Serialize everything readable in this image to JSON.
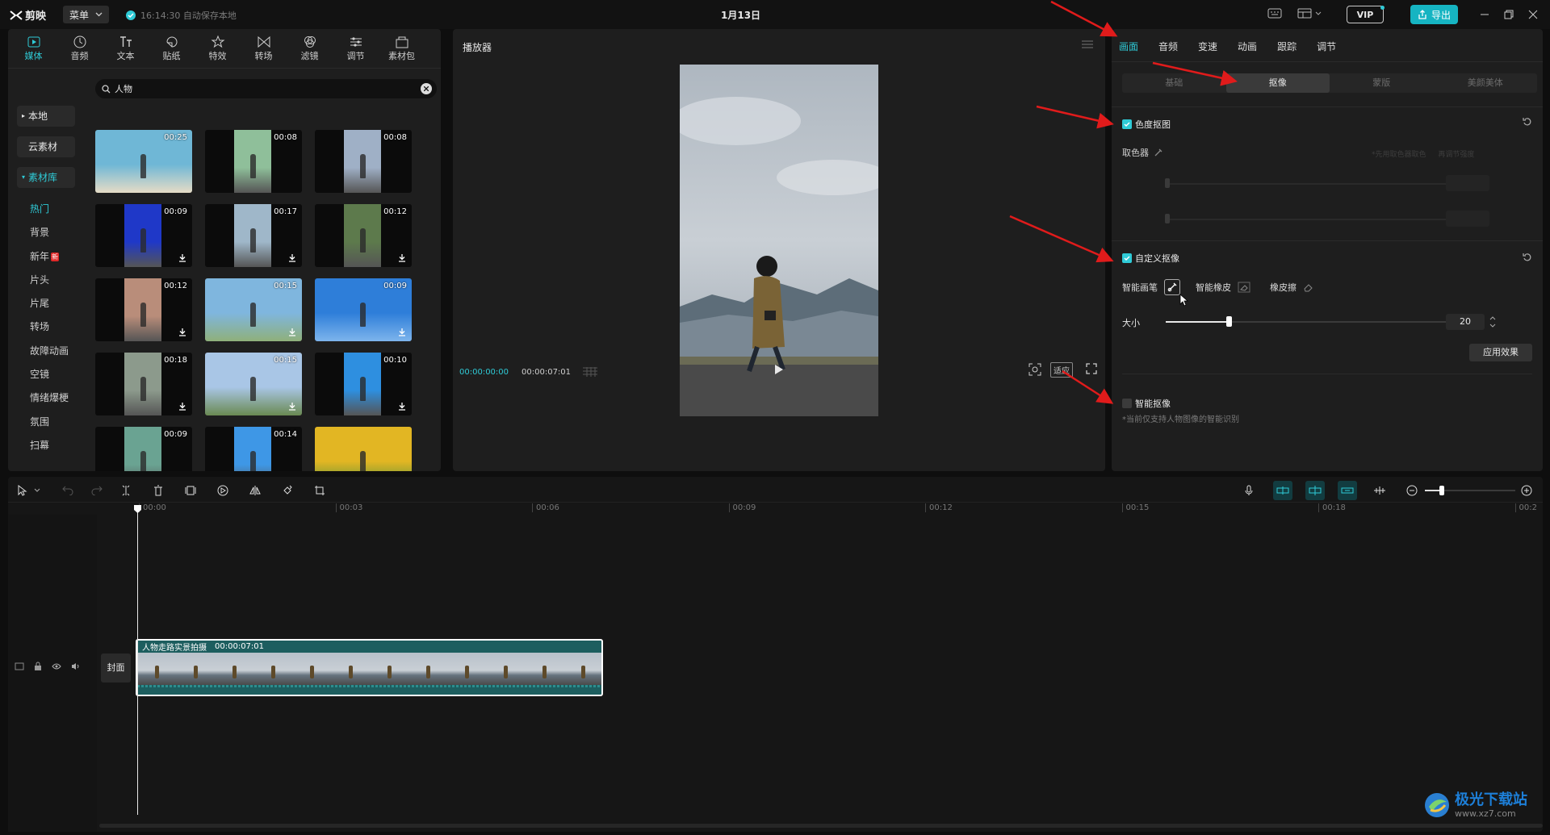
{
  "titlebar": {
    "logo": "剪映",
    "menu_label": "菜单",
    "autosave": "16:14:30 自动保存本地",
    "project_title": "1月13日",
    "vip_label": "VIP",
    "export_label": "导出"
  },
  "toolbar": {
    "tools": [
      {
        "label": "媒体",
        "icon": "media-icon",
        "active": true
      },
      {
        "label": "音频",
        "icon": "audio-icon"
      },
      {
        "label": "文本",
        "icon": "text-icon"
      },
      {
        "label": "贴纸",
        "icon": "sticker-icon"
      },
      {
        "label": "特效",
        "icon": "effects-icon"
      },
      {
        "label": "转场",
        "icon": "transition-icon"
      },
      {
        "label": "滤镜",
        "icon": "filter-icon"
      },
      {
        "label": "调节",
        "icon": "adjust-icon"
      },
      {
        "label": "素材包",
        "icon": "material-pack-icon"
      }
    ]
  },
  "media_sidebar": {
    "local": "本地",
    "cloud": "云素材",
    "library": "素材库",
    "items": [
      "热门",
      "背景",
      "新年",
      "片头",
      "片尾",
      "转场",
      "故障动画",
      "空镜",
      "情绪爆梗",
      "氛围",
      "扫幕"
    ],
    "new_badge": "新"
  },
  "search": {
    "value": "人物"
  },
  "media_grid": [
    {
      "dur": "00:25",
      "dl": false
    },
    {
      "dur": "00:08",
      "dl": false
    },
    {
      "dur": "00:08",
      "dl": false
    },
    {
      "dur": "00:09",
      "dl": true
    },
    {
      "dur": "00:17",
      "dl": true
    },
    {
      "dur": "00:12",
      "dl": true
    },
    {
      "dur": "00:12",
      "dl": true
    },
    {
      "dur": "00:15",
      "dl": true
    },
    {
      "dur": "00:09",
      "dl": true
    },
    {
      "dur": "00:18",
      "dl": true
    },
    {
      "dur": "00:15",
      "dl": true
    },
    {
      "dur": "00:10",
      "dl": true
    },
    {
      "dur": "00:09",
      "dl": false
    },
    {
      "dur": "00:14",
      "dl": false
    },
    {
      "dur": "",
      "dl": false
    }
  ],
  "player": {
    "title": "播放器",
    "current_time": "00:00:00:00",
    "total_time": "00:00:07:01",
    "fit_label": "适应"
  },
  "props": {
    "tabs": [
      "画面",
      "音频",
      "变速",
      "动画",
      "跟踪",
      "调节"
    ],
    "subtabs": [
      "基础",
      "抠像",
      "蒙版",
      "美颜美体"
    ],
    "chroma_key": {
      "label": "色度抠图",
      "picker_label": "取色器",
      "picker_hint": "*先用取色器取色",
      "picker_hint2": "再调节强度"
    },
    "custom_key": {
      "label": "自定义抠像",
      "smart_brush": "智能画笔",
      "smart_eraser": "智能橡皮",
      "eraser": "橡皮擦",
      "size_label": "大小",
      "size_value": "20",
      "size_fraction": 0.2,
      "apply_label": "应用效果"
    },
    "smart_key": {
      "label": "智能抠像",
      "note": "*当前仅支持人物图像的智能识别"
    }
  },
  "timeline": {
    "ruler": [
      "00:00",
      "00:03",
      "00:06",
      "00:09",
      "00:12",
      "00:15",
      "00:18",
      "00:2"
    ],
    "cover_label": "封面",
    "clip_name": "人物走路实景拍摄",
    "clip_duration": "00:00:07:01"
  },
  "watermark": {
    "text": "极光下载站",
    "url": "www.xz7.com"
  },
  "colors": {
    "accent": "#2fcbd7",
    "arrow": "#e01b1b",
    "clip": "#1d5e5f"
  }
}
